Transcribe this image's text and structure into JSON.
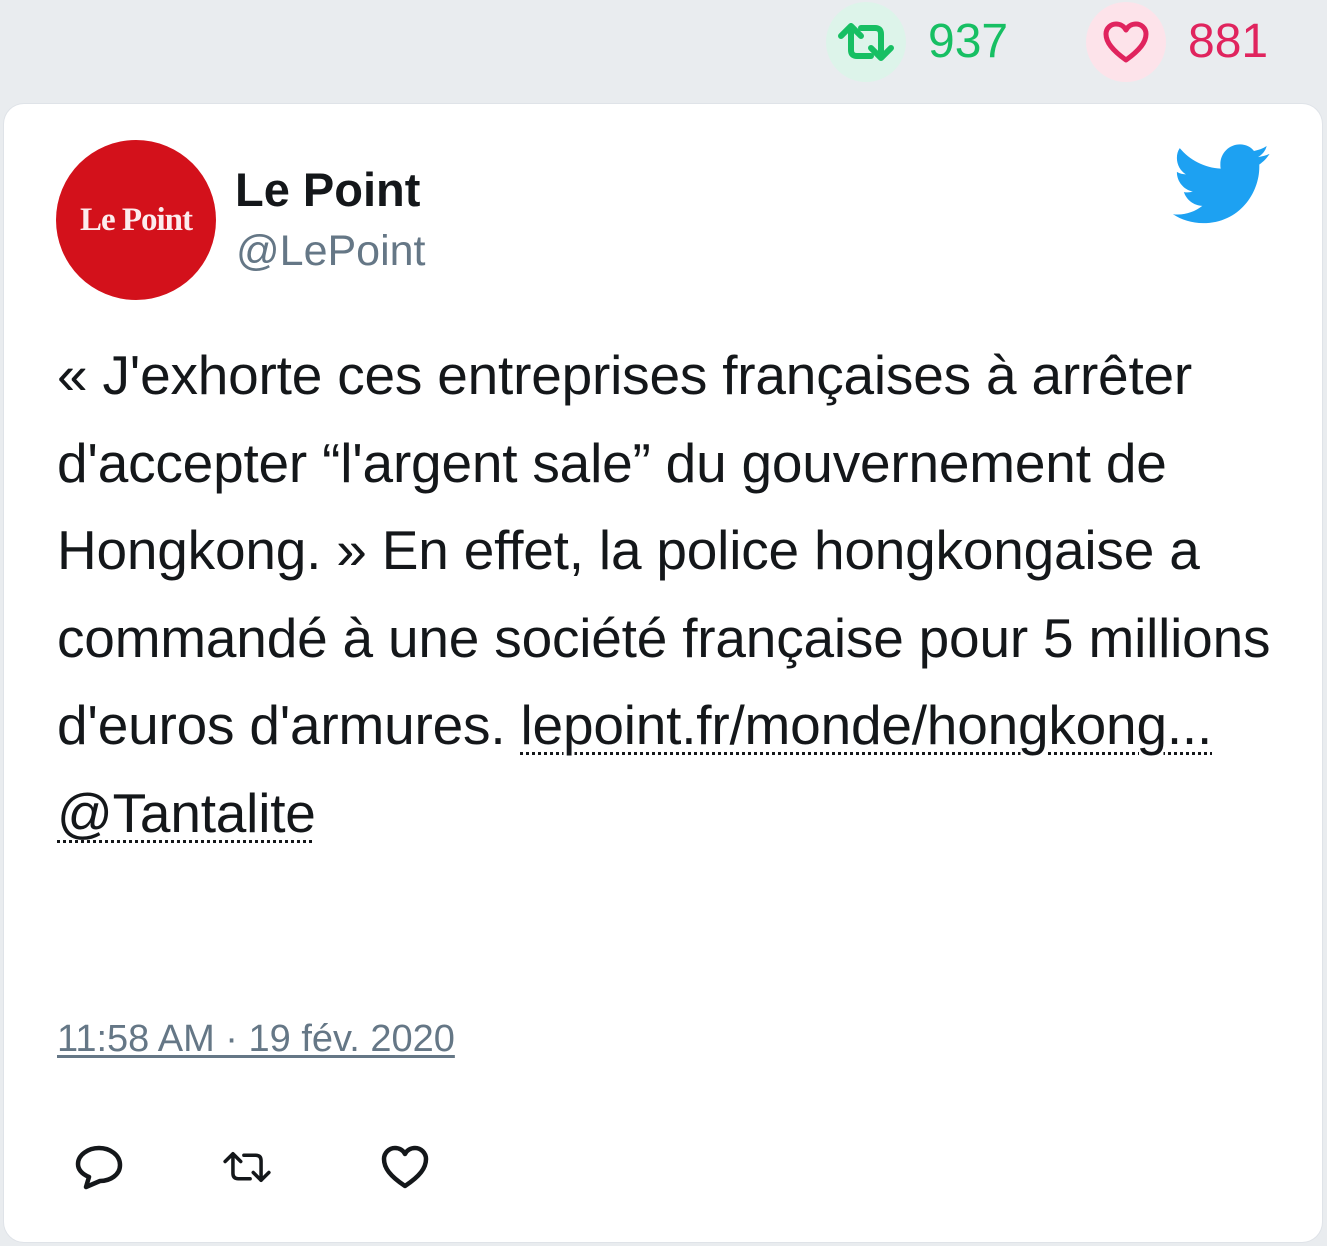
{
  "stats": {
    "retweet_count": "937",
    "like_count": "881"
  },
  "tweet": {
    "avatar_text": "Le Point",
    "display_name": "Le Point",
    "handle": "@LePoint",
    "text": "« J'exhorte ces entreprises françaises à arrêter d'accepter “l'argent sale” du gouvernement de Hongkong. » En effet, la police hongkongaise a commandé à une société française pour 5 millions d'euros d'armures.",
    "link": "lepoint.fr/monde/hongkong...",
    "mention": "@Tantalite",
    "timestamp": "11:58 AM · 19 fév. 2020"
  },
  "colors": {
    "retweet": "#17bf63",
    "like": "#e0245e",
    "twitter_blue": "#1da1f2",
    "avatar_red": "#d3111b"
  },
  "icons": [
    "retweet-icon",
    "heart-icon",
    "twitter-bird-icon",
    "reply-icon"
  ]
}
